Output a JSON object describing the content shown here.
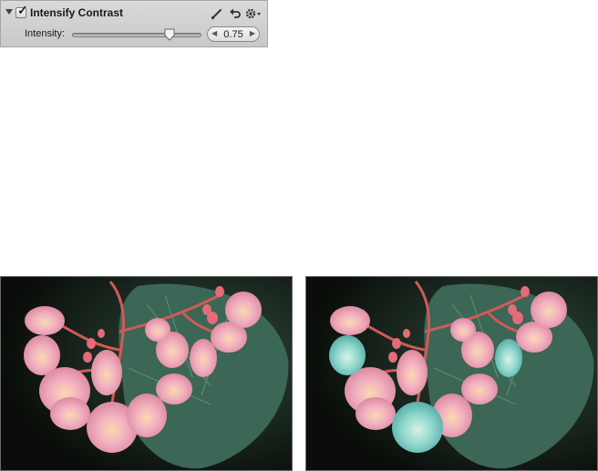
{
  "panel": {
    "title": "Intensify Contrast",
    "enabled": true,
    "icons": [
      "brush-icon",
      "undo-icon",
      "gear-icon"
    ],
    "parameter": {
      "label": "Intensity:",
      "value": "0.75",
      "fraction": 0.75
    }
  },
  "photos": {
    "left": "begonia-original",
    "right": "begonia-with-overlay"
  },
  "colors": {
    "petal": "#f0a6b6",
    "petal_cyan": "#7fd1c7",
    "leaf": "#3f6b58",
    "stem": "#d05a55",
    "background": "#0b0f0a"
  }
}
